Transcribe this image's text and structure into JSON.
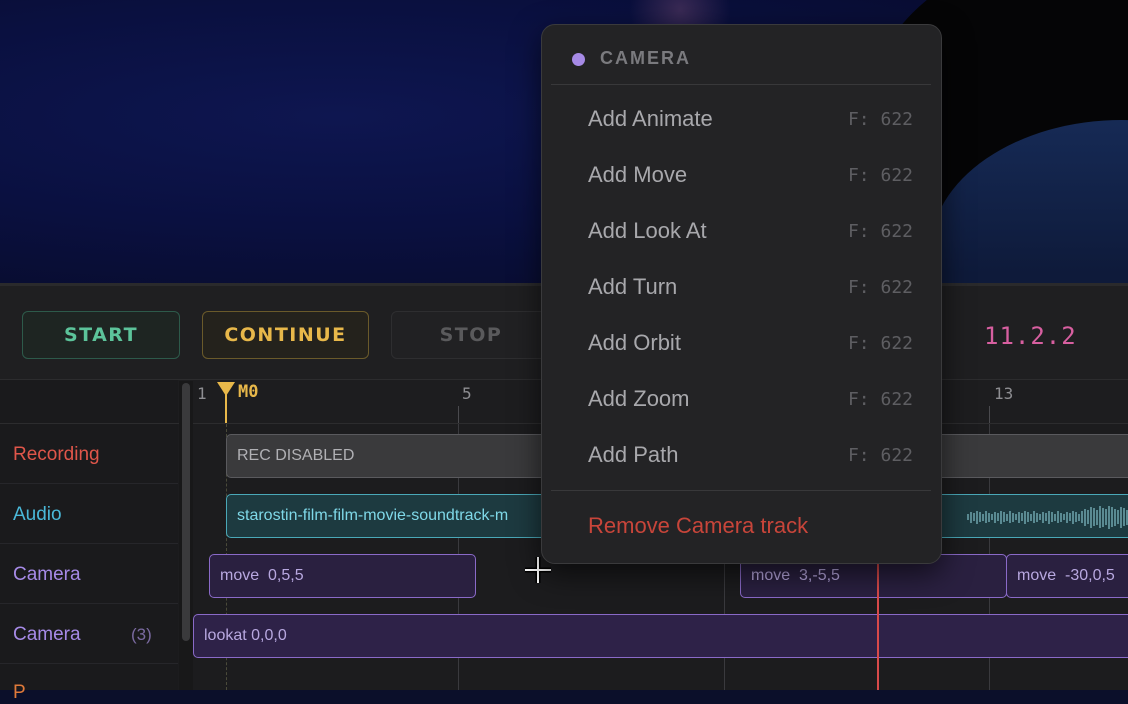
{
  "toolbar": {
    "start_label": "START",
    "continue_label": "CONTINUE",
    "stop_label": "STOP",
    "frame_readout": "11.2.2"
  },
  "ruler": {
    "ticks": [
      "1",
      "5",
      "13"
    ],
    "marker": "M0"
  },
  "tracks": {
    "labels": [
      {
        "name": "Recording",
        "color": "#e0564a"
      },
      {
        "name": "Audio",
        "color": "#4ab8d8"
      },
      {
        "name": "Camera",
        "color": "#a68ae6"
      },
      {
        "name": "Camera",
        "color": "#a68ae6",
        "count": "(3)"
      }
    ],
    "partial_label": "P"
  },
  "clips": {
    "recording": "REC DISABLED",
    "audio": "starostin-film-film-movie-soundtrack-m",
    "moves": [
      {
        "label": "move",
        "value": "0,5,5"
      },
      {
        "label": "move",
        "value": "3,-5,5"
      },
      {
        "label": "move",
        "value": "-30,0,5"
      }
    ],
    "lookat": "lookat 0,0,0"
  },
  "menu": {
    "title": "CAMERA",
    "accent": "#a68ae6",
    "items": [
      {
        "label": "Add Animate",
        "shortcut": "F: 622"
      },
      {
        "label": "Add Move",
        "shortcut": "F: 622"
      },
      {
        "label": "Add Look At",
        "shortcut": "F: 622"
      },
      {
        "label": "Add Turn",
        "shortcut": "F: 622"
      },
      {
        "label": "Add Orbit",
        "shortcut": "F: 622"
      },
      {
        "label": "Add Zoom",
        "shortcut": "F: 622"
      },
      {
        "label": "Add Path",
        "shortcut": "F: 622"
      }
    ],
    "danger": "Remove Camera track",
    "danger_color": "#c8453a"
  },
  "icons": {
    "cursor": "crosshair-cursor-icon"
  }
}
